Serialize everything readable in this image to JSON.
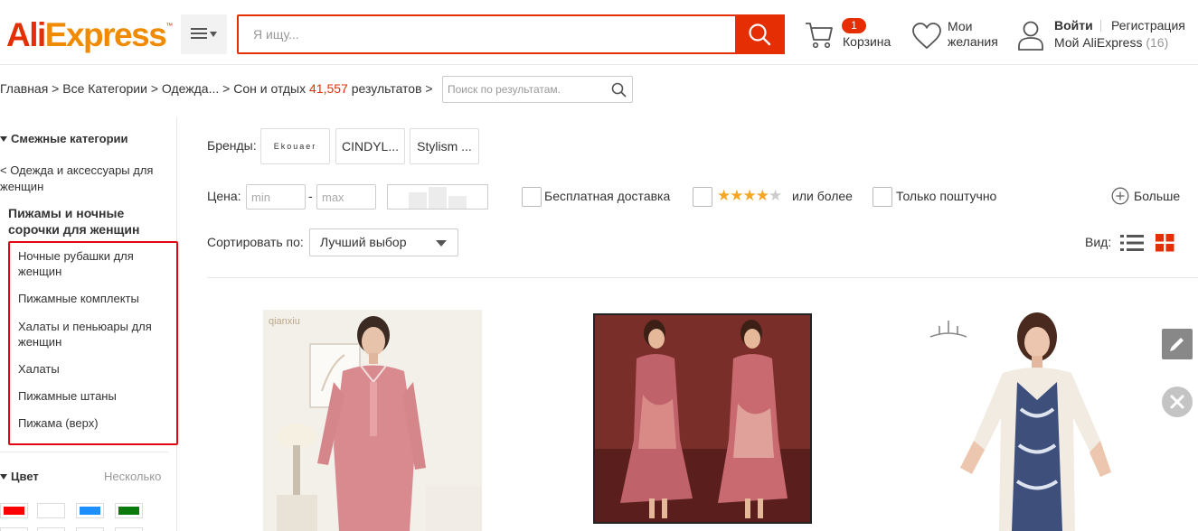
{
  "header": {
    "logo": "AliExpress",
    "search_placeholder": "Я ищу...",
    "cart": {
      "count": "1",
      "label": "Корзина"
    },
    "wishlist": {
      "line1": "Мои",
      "line2": "желания"
    },
    "account": {
      "signin": "Войти",
      "register": "Регистрация",
      "my": "Мой AliExpress",
      "count": "(16)"
    }
  },
  "breadcrumb": {
    "prefix": "Главная > Все Категории > Одежда... > ",
    "current": "Сон и отдых ",
    "count": "41,557",
    "suffix": " результатов >",
    "search_placeholder": "Поиск по результатам."
  },
  "sidebar": {
    "title": "Смежные категории",
    "parent": "< Одежда и аксессуары для женщин",
    "current": "Пижамы и ночные сорочки для женщин",
    "items": [
      {
        "label": "Ночные рубашки для женщин"
      },
      {
        "label": "Пижамные комплекты"
      },
      {
        "label": "Халаты и пеньюары для женщин"
      },
      {
        "label": "Халаты"
      },
      {
        "label": "Пижамные штаны"
      },
      {
        "label": "Пижама (верх)"
      }
    ],
    "color_title": "Цвет",
    "color_multi": "Несколько",
    "swatches": [
      "#ff0000",
      "#ffffff",
      "#1e8fff",
      "#0a7a0a"
    ]
  },
  "filters": {
    "brands_label": "Бренды:",
    "brands": [
      "Ekouaer",
      "CINDYL...",
      "Stylism ..."
    ],
    "price_label": "Цена:",
    "min_placeholder": "min",
    "max_placeholder": "max",
    "free_shipping": "Бесплатная доставка",
    "rating_suffix": "или более",
    "single_piece": "Только поштучно",
    "more": "Больше",
    "sort_label": "Сортировать по:",
    "sort_value": "Лучший выбор",
    "view_label": "Вид:"
  },
  "products": [
    {
      "brand_mark": "qianxiu"
    },
    {
      "brand_mark": ""
    },
    {
      "brand_mark": ""
    }
  ],
  "colors": {
    "accent": "#e62e04",
    "highlight_box": "#e30613",
    "star": "#f5a623"
  }
}
